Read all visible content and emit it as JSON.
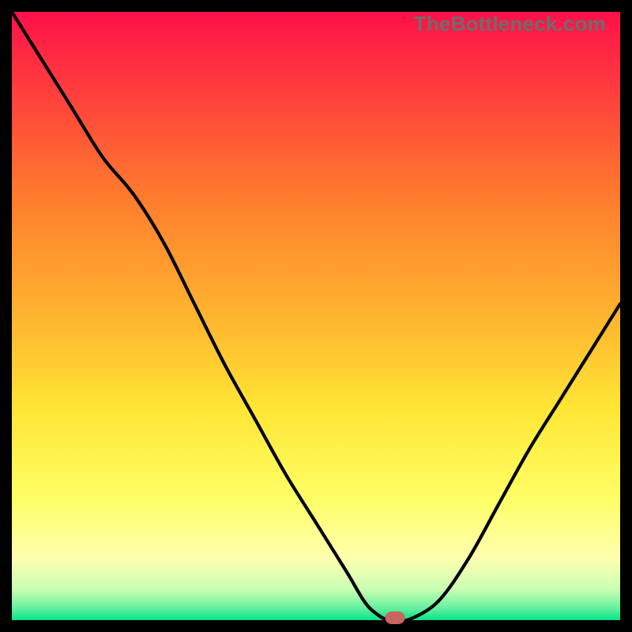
{
  "watermark": "TheBottleneck.com",
  "colors": {
    "gradient_top": "#ff1049",
    "gradient_mid1": "#ff7a2e",
    "gradient_mid2": "#ffe534",
    "gradient_mid3": "#feffb0",
    "gradient_bottom": "#06e386",
    "curve": "#000000",
    "marker": "#c96560",
    "frame": "#000000"
  },
  "chart_data": {
    "type": "line",
    "title": "",
    "xlabel": "",
    "ylabel": "",
    "xlim": [
      0,
      100
    ],
    "ylim": [
      0,
      100
    ],
    "x": [
      0,
      5,
      10,
      15,
      20,
      25,
      30,
      35,
      40,
      45,
      50,
      55,
      58,
      60,
      62,
      65,
      70,
      75,
      80,
      85,
      90,
      95,
      100
    ],
    "values": [
      100,
      92,
      84,
      76,
      70,
      62,
      52,
      42,
      33,
      24,
      16,
      8,
      3,
      1,
      0,
      0,
      3,
      10,
      19,
      28,
      36,
      44,
      52
    ],
    "marker": {
      "x": 63,
      "y": 0
    },
    "grid": false,
    "legend": false
  }
}
